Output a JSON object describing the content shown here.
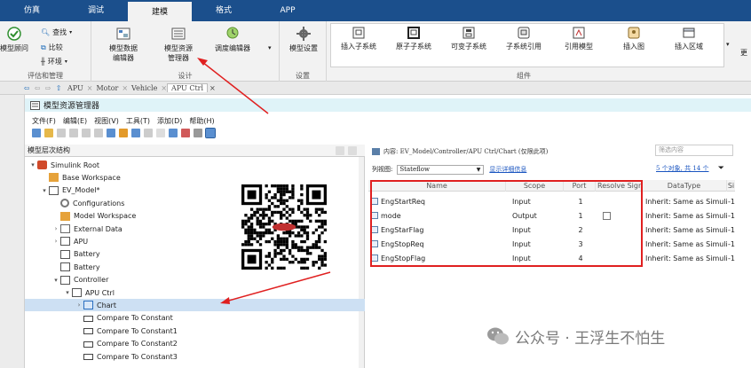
{
  "ribbon_tabs": [
    "仿真",
    "调试",
    "建模",
    "格式",
    "APP"
  ],
  "ribbon": {
    "eval_group": {
      "label": "评估和管理",
      "model_advisor": "模型顾问",
      "find": "查找",
      "compare": "比较",
      "environment": "环境"
    },
    "design_group": {
      "label": "设计",
      "model_data_editor": [
        "模型数据",
        "编辑器"
      ],
      "model_explorer": [
        "模型资源",
        "管理器"
      ],
      "schedule_editor": "调度编辑器"
    },
    "setup_group": {
      "label": "设置",
      "model_settings": "模型设置"
    },
    "component_group": {
      "label": "组件",
      "insert_subsystem": "插入子系统",
      "atomic_subsystem": "原子子系统",
      "variant_subsystem": "可变子系统",
      "subsystem_reference": "子系统引用",
      "reference_model": "引用模型",
      "insert_image": "插入图",
      "insert_area": "插入区域",
      "more": "更"
    }
  },
  "breadcrumb": [
    "APU",
    "Motor",
    "Vehicle",
    "APU Ctrl"
  ],
  "explorer": {
    "title": "模型资源管理器",
    "menu": [
      "文件(F)",
      "编辑(E)",
      "视图(V)",
      "工具(T)",
      "添加(D)",
      "帮助(H)"
    ],
    "hierarchy_title": "模型层次结构",
    "tree": [
      {
        "label": "Simulink Root",
        "indent": 0,
        "twisty": "▾",
        "icon": "simulink-root-icon"
      },
      {
        "label": "Base Workspace",
        "indent": 1,
        "twisty": "",
        "icon": "workspace-icon"
      },
      {
        "label": "EV_Model*",
        "indent": 1,
        "twisty": "▾",
        "icon": "model-icon"
      },
      {
        "label": "Configurations",
        "indent": 2,
        "twisty": "",
        "icon": "configuration-icon"
      },
      {
        "label": "Model Workspace",
        "indent": 2,
        "twisty": "",
        "icon": "workspace-icon"
      },
      {
        "label": "External Data",
        "indent": 2,
        "twisty": "›",
        "icon": "external-data-icon"
      },
      {
        "label": "APU",
        "indent": 2,
        "twisty": "›",
        "icon": "subsystem-icon"
      },
      {
        "label": "Battery",
        "indent": 2,
        "twisty": "",
        "icon": "subsystem-icon"
      },
      {
        "label": "Battery",
        "indent": 2,
        "twisty": "",
        "icon": "subsystem-icon"
      },
      {
        "label": "Controller",
        "indent": 2,
        "twisty": "▾",
        "icon": "subsystem-icon"
      },
      {
        "label": "APU Ctrl",
        "indent": 3,
        "twisty": "▾",
        "icon": "subsystem-icon"
      },
      {
        "label": "Chart",
        "indent": 4,
        "twisty": "›",
        "icon": "chart-icon",
        "selected": true
      },
      {
        "label": "Compare To Constant",
        "indent": 4,
        "twisty": "",
        "icon": "block-icon"
      },
      {
        "label": "Compare To Constant1",
        "indent": 4,
        "twisty": "",
        "icon": "block-icon"
      },
      {
        "label": "Compare To Constant2",
        "indent": 4,
        "twisty": "",
        "icon": "block-icon"
      },
      {
        "label": "Compare To Constant3",
        "indent": 4,
        "twisty": "",
        "icon": "block-icon"
      }
    ],
    "content_header": "内容: EV_Model/Controller/APU Ctrl/Chart (仅限此项)",
    "filter_placeholder": "筛选内容",
    "view_label": "列视图:",
    "view_value": "Stateflow",
    "show_details": "显示详细信息",
    "object_count": "5 个对象, 共 14 个",
    "columns": [
      "Name",
      "Scope",
      "Port",
      "Resolve Signal",
      "DataType",
      "Si"
    ],
    "rows": [
      {
        "name": "EngStartReq",
        "scope": "Input",
        "port": "1",
        "resolve": false,
        "datatype": "Inherit: Same as Simulink",
        "size": "-1"
      },
      {
        "name": "mode",
        "scope": "Output",
        "port": "1",
        "resolve": true,
        "datatype": "Inherit: Same as Simulink",
        "size": "-1"
      },
      {
        "name": "EngStarFlag",
        "scope": "Input",
        "port": "2",
        "resolve": false,
        "datatype": "Inherit: Same as Simulink",
        "size": "-1"
      },
      {
        "name": "EngStopReq",
        "scope": "Input",
        "port": "3",
        "resolve": false,
        "datatype": "Inherit: Same as Simulink",
        "size": "-1"
      },
      {
        "name": "EngStopFlag",
        "scope": "Input",
        "port": "4",
        "resolve": false,
        "datatype": "Inherit: Same as Simulink",
        "size": "-1"
      }
    ]
  },
  "watermark": "公众号 · 王浮生不怕生",
  "colors": {
    "ribbon_blue": "#1b4f8c",
    "selection": "#cde0f3",
    "highlight_red": "#e02020"
  }
}
